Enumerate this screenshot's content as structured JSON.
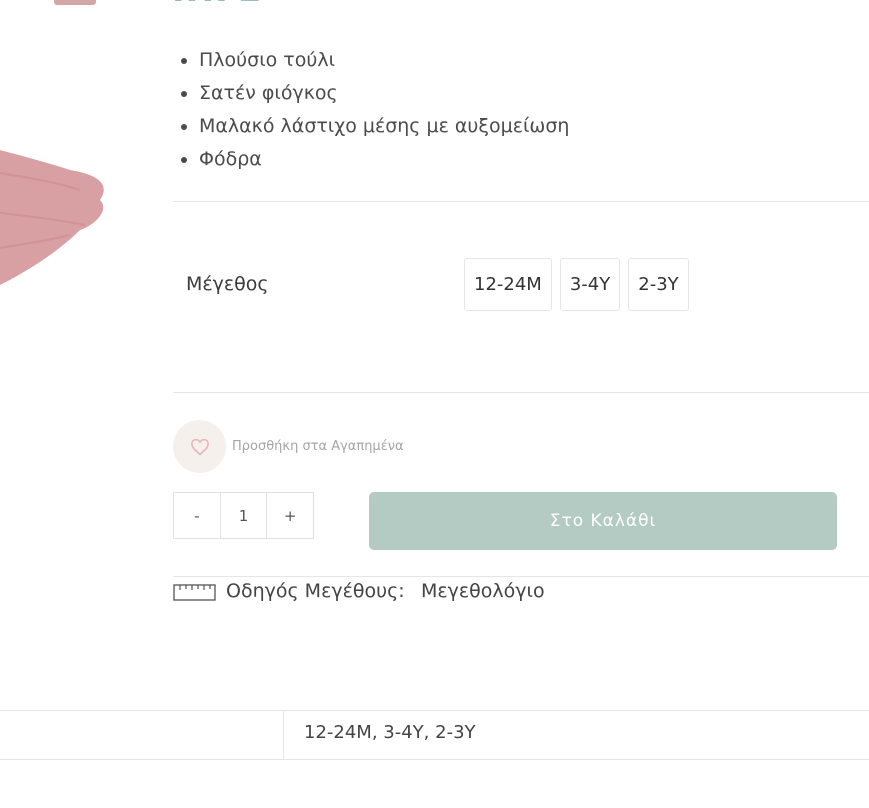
{
  "product": {
    "price_partial": "ΙΗΓΕ",
    "features": [
      "Πλούσιο τούλι",
      "Σατέν φιόγκος",
      "Μαλακό λάστιχο μέσης με αυξομείωση",
      "Φόδρα"
    ]
  },
  "size": {
    "label": "Μέγεθος",
    "options": [
      "12-24M",
      "3-4Y",
      "2-3Y"
    ]
  },
  "wishlist": {
    "label": "Προσθήκη στα Αγαπημένα",
    "icon": "heart-icon"
  },
  "quantity": {
    "minus": "-",
    "value": "1",
    "plus": "+"
  },
  "cart": {
    "button_label": "Στο Καλάθι",
    "color": "#b3cbc3"
  },
  "size_guide": {
    "label": "Οδηγός Μεγέθους:",
    "link": "Μεγεθολόγιο",
    "icon": "ruler-icon"
  },
  "attributes_table": {
    "sizes_value": "12-24M, 3-4Y, 2-3Y"
  },
  "colors": {
    "accent": "#93bfb5",
    "heart": "#e7b7be",
    "wishlist_bg": "#f6f0ec"
  }
}
